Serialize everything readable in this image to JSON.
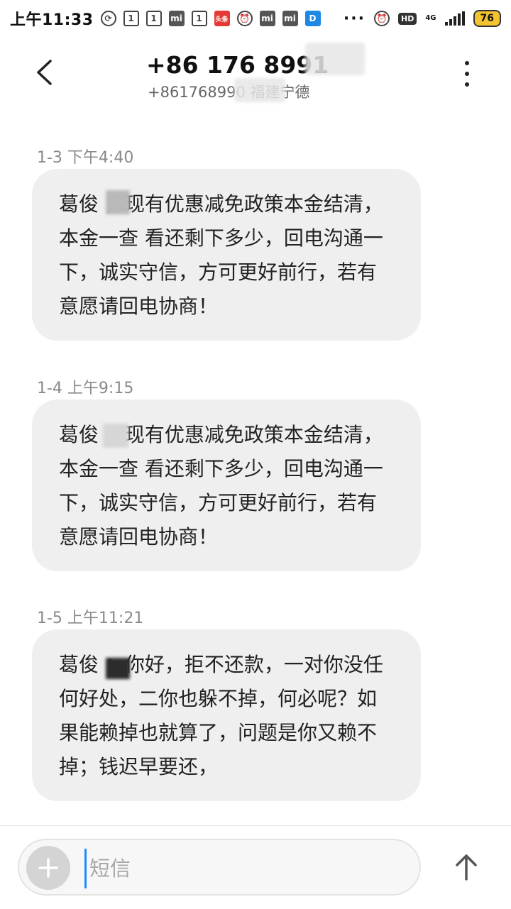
{
  "status_bar": {
    "time": "上午11:33",
    "more": "···",
    "hd": "HD",
    "network": "4G",
    "battery": "76"
  },
  "header": {
    "number": "+86 176 8991",
    "subtitle": "+861768990  福建宁德"
  },
  "messages": [
    {
      "timestamp": "1-3 下午4:40",
      "text": "葛俊    ，现有优惠减免政策本金结清，本金一查 看还剩下多少，回电沟通一下，诚实守信，方可更好前行，若有意愿请回电协商！"
    },
    {
      "timestamp": "1-4 上午9:15",
      "text": "葛俊    ，现有优惠减免政策本金结清，本金一查 看还剩下多少，回电沟通一下，诚实守信，方可更好前行，若有意愿请回电协商！"
    },
    {
      "timestamp": "1-5 上午11:21",
      "text": "葛俊    ：你好，拒不还款，一对你没任何好处，二你也躲不掉，何必呢？如果能赖掉也就算了，问题是你又赖不掉；钱迟早要还，"
    }
  ],
  "composer": {
    "placeholder": "短信"
  }
}
